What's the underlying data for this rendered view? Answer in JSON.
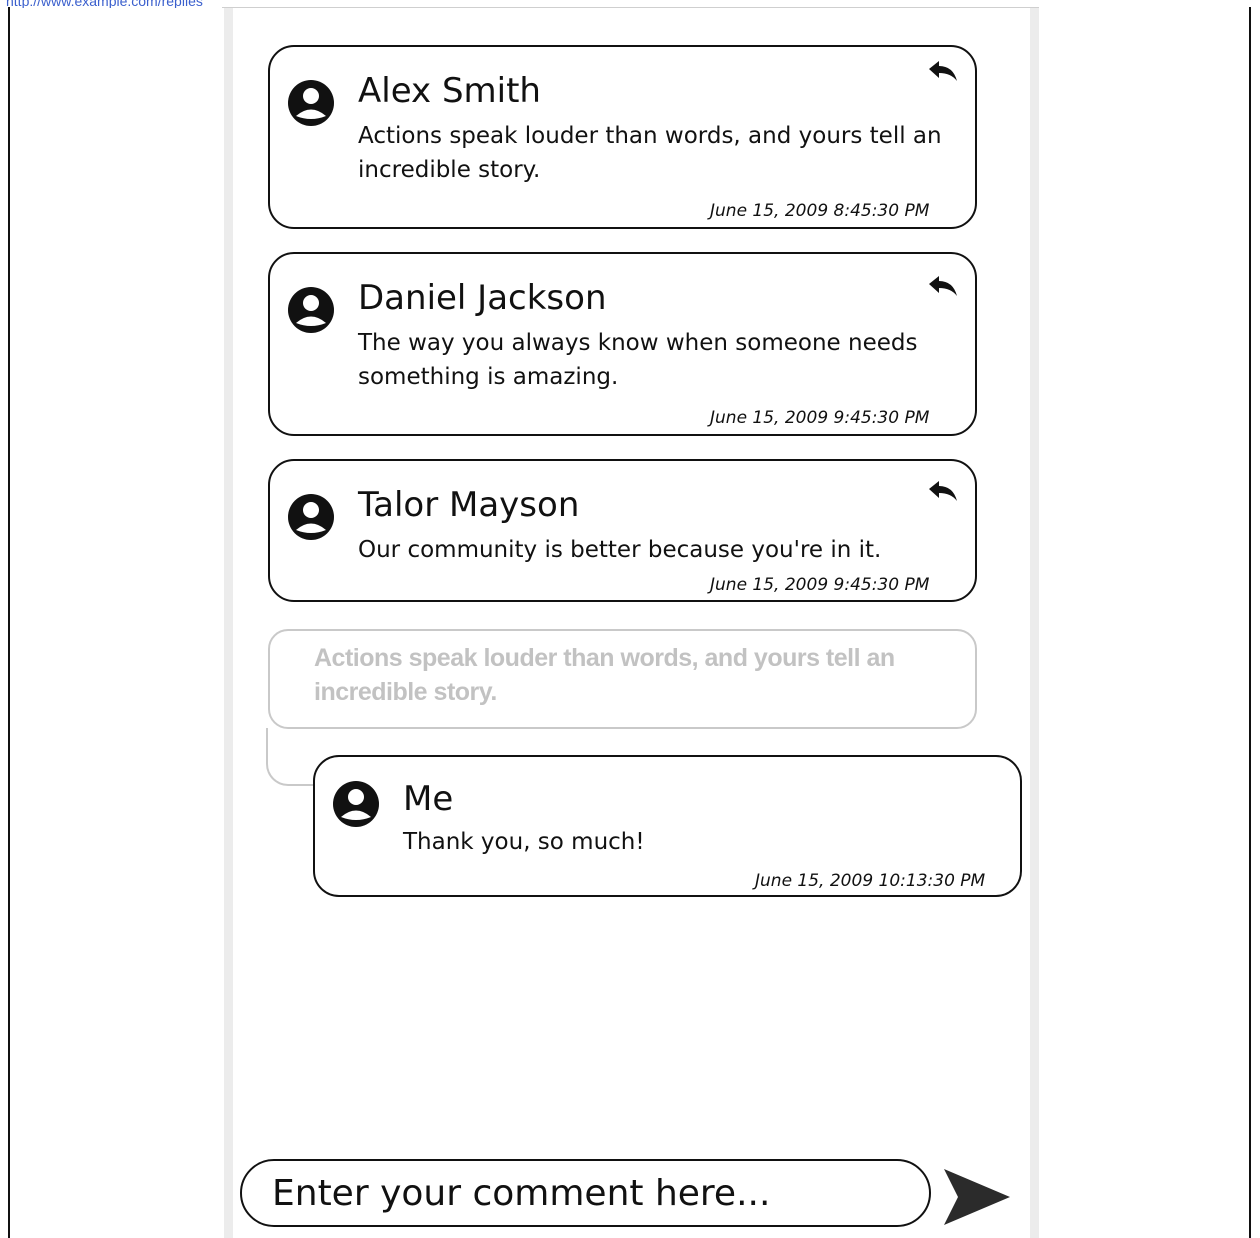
{
  "comments": [
    {
      "name": "Alex Smith",
      "text": "Actions speak louder than words, and yours tell an incredible story.",
      "time": "June 15, 2009 8:45:30 PM",
      "icon": "user-avatar-icon",
      "reply_icon": "reply-arrow-icon"
    },
    {
      "name": "Daniel Jackson",
      "text": "The way you always know when someone needs something is amazing.",
      "time": "June 15, 2009 9:45:30 PM",
      "icon": "user-avatar-icon",
      "reply_icon": "reply-arrow-icon"
    },
    {
      "name": "Talor Mayson",
      "text": "Our community is better because you're in it.",
      "time": "June 15, 2009 9:45:30 PM",
      "icon": "user-avatar-icon",
      "reply_icon": "reply-arrow-icon"
    }
  ],
  "reply": {
    "quoted_text": "Actions speak louder than words, and yours tell an incredible story.",
    "name": "Me",
    "text": "Thank you, so much!",
    "time": "June 15, 2009 10:13:30 PM",
    "icon": "user-avatar-icon"
  },
  "composer": {
    "placeholder": "Enter your comment here...",
    "send_icon": "send-icon"
  },
  "colors": {
    "ink": "#111111",
    "quoted_text": "#c2c2c2",
    "quoted_border": "#c9c9c9",
    "panel_border": "#ececec"
  }
}
